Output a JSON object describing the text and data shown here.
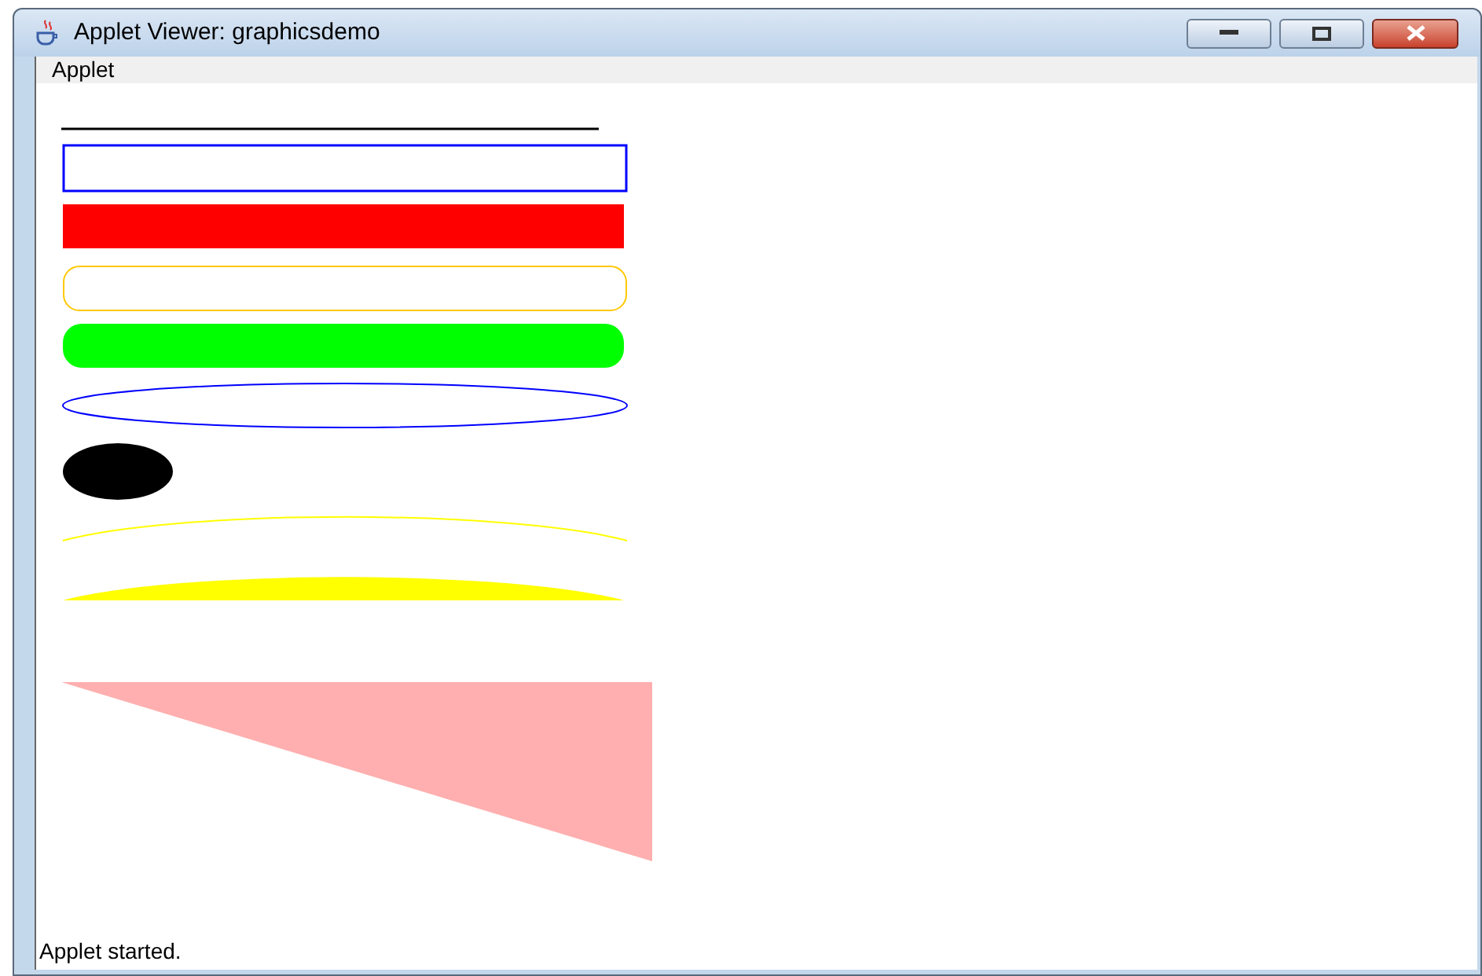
{
  "window": {
    "title": "Applet Viewer: graphicsdemo"
  },
  "menu": [
    {
      "label": "Applet"
    }
  ],
  "canvas": {
    "shapes": [
      {
        "kind": "line",
        "color": "#000000"
      },
      {
        "kind": "rect",
        "color": "#0000ff"
      },
      {
        "kind": "fill-rect",
        "color": "#ff0000"
      },
      {
        "kind": "round-rect",
        "color": "#ffc800"
      },
      {
        "kind": "fill-round-rect",
        "color": "#00ff00"
      },
      {
        "kind": "oval",
        "color": "#0000ff"
      },
      {
        "kind": "fill-oval",
        "color": "#000000"
      },
      {
        "kind": "arc",
        "color": "#ffff00"
      },
      {
        "kind": "fill-arc",
        "color": "#ffff00"
      },
      {
        "kind": "polygon",
        "color": "#ffafaf"
      }
    ]
  },
  "status_bar": "Applet started."
}
